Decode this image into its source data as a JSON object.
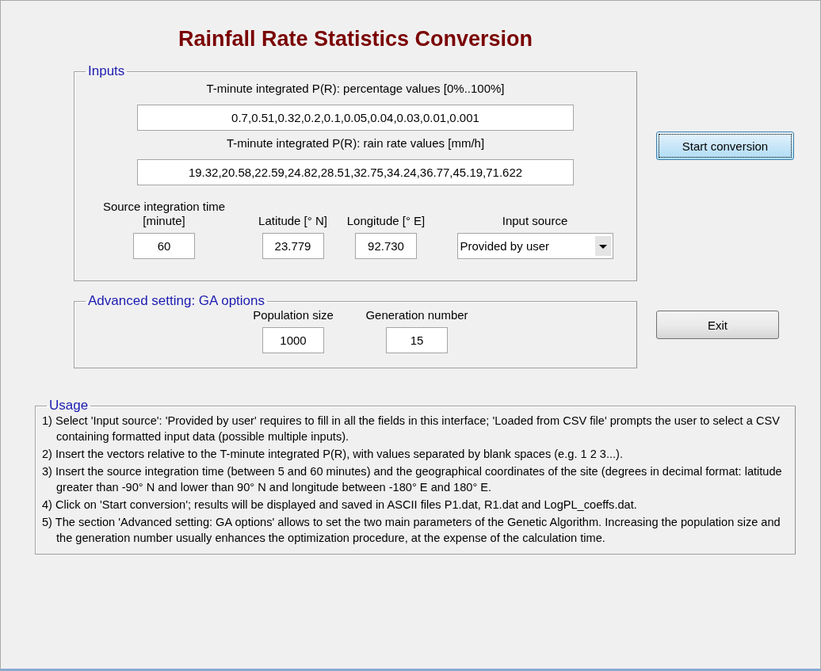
{
  "title": "Rainfall Rate Statistics Conversion",
  "inputs": {
    "legend": "Inputs",
    "vectors": [
      {
        "label": "T-minute integrated P(R): percentage values [0%..100%]",
        "value": "0.7,0.51,0.32,0.2,0.1,0.05,0.04,0.03,0.01,0.001"
      },
      {
        "label": "T-minute integrated P(R): rain rate values [mm/h]",
        "value": "19.32,20.58,22.59,24.82,28.51,32.75,34.24,36.77,45.19,71.622"
      }
    ],
    "params": [
      {
        "kind": "text",
        "label": "Source integration time [minute]",
        "value": "60"
      },
      {
        "kind": "text",
        "label": "Latitude [° N]",
        "value": "23.779"
      },
      {
        "kind": "text",
        "label": "Longitude [° E]",
        "value": "92.730"
      },
      {
        "kind": "dropdown",
        "label": "Input source",
        "value": "Provided by user"
      }
    ]
  },
  "advanced": {
    "legend": "Advanced setting: GA options",
    "params": [
      {
        "label": "Population size",
        "value": "1000"
      },
      {
        "label": "Generation number",
        "value": "15"
      }
    ]
  },
  "buttons": [
    {
      "label": "Start conversion",
      "focused": true
    },
    {
      "label": "Exit",
      "focused": false
    }
  ],
  "usage": {
    "legend": "Usage",
    "items": [
      "1) Select 'Input source': 'Provided by user' requires  to fill in all the fields in this interface; 'Loaded from CSV file' prompts the user to select a CSV containing formatted input data (possible multiple inputs).",
      "2) Insert the vectors relative to the T-minute integrated P(R), with values separated by blank spaces (e.g. 1 2 3...).",
      "3) Insert the source integration time (between 5 and 60 minutes) and the geographical coordinates of the site (degrees in decimal format: latitude greater than -90° N and lower than 90° N and longitude between -180° E and 180° E.",
      "4) Click on 'Start conversion'; results will be displayed and saved in ASCII files P1.dat, R1.dat and LogPL_coeffs.dat.",
      "5) The section 'Advanced setting: GA options' allows to set the two main parameters of the Genetic Algorithm. Increasing the population size and the generation number usually enhances the optimization procedure, at the expense of the calculation time."
    ]
  }
}
